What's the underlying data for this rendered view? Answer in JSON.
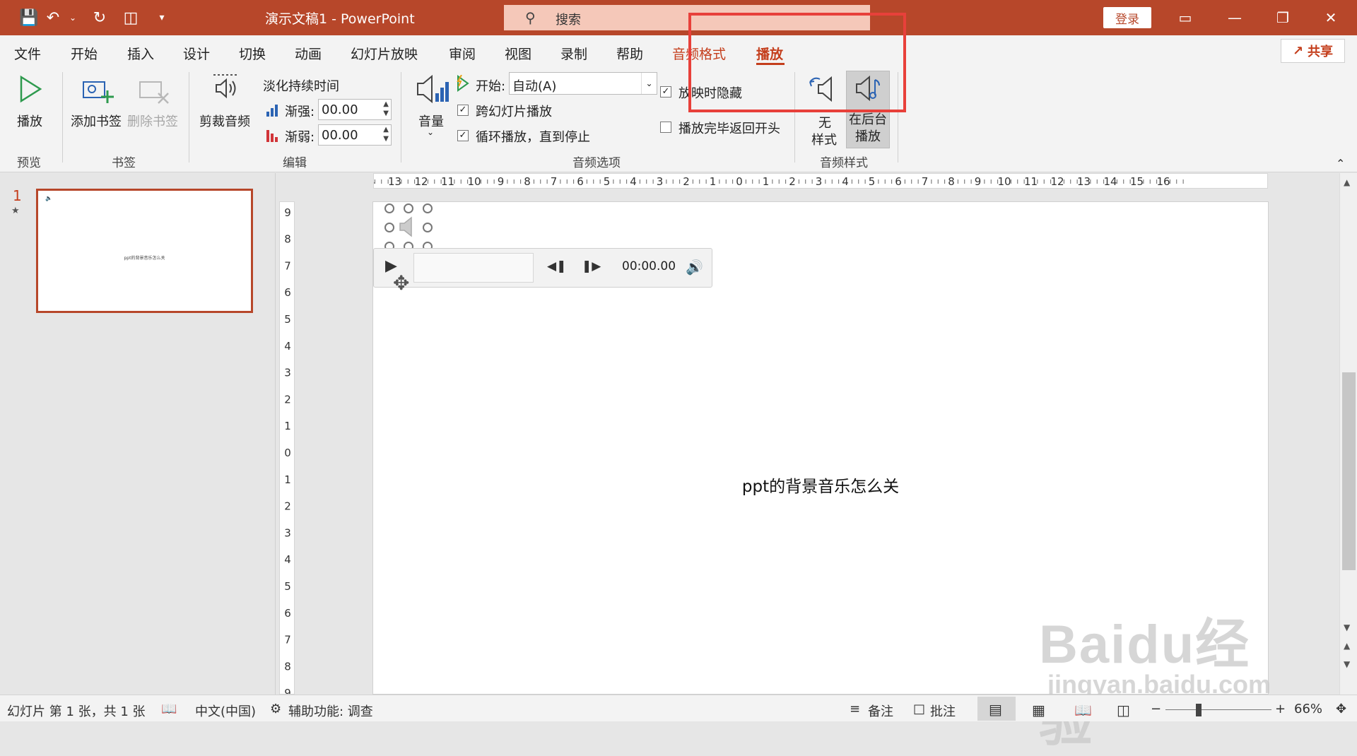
{
  "titlebar": {
    "doc_title": "演示文稿1  -  PowerPoint",
    "search_placeholder": "搜索",
    "login_label": "登录",
    "quick_access_icons": [
      "save-icon",
      "undo-icon",
      "redo-icon",
      "present-icon",
      "customize-icon"
    ]
  },
  "tabs": [
    "文件",
    "开始",
    "插入",
    "设计",
    "切换",
    "动画",
    "幻灯片放映",
    "审阅",
    "视图",
    "录制",
    "帮助",
    "音频格式",
    "播放"
  ],
  "active_tab": "播放",
  "share_label": "共享",
  "ribbon": {
    "play_label": "播放",
    "preview_group": "预览",
    "add_bookmark": "添加书签",
    "remove_bookmark": "删除书签",
    "bookmark_group": "书签",
    "trim_audio": "剪裁音频",
    "fade_duration": "淡化持续时间",
    "fade_in_label": "渐强:",
    "fade_in_value": "00.00",
    "fade_out_label": "渐弱:",
    "fade_out_value": "00.00",
    "edit_group": "编辑",
    "volume_label": "音量",
    "start_label": "开始:",
    "start_value": "自动(A)",
    "play_across_slides": "跨幻灯片播放",
    "play_across_slides_checked": true,
    "loop_until_stopped": "循环播放，直到停止",
    "loop_until_stopped_checked": true,
    "hide_during_show": "放映时隐藏",
    "hide_during_show_checked": true,
    "rewind_after_playing": "播放完毕返回开头",
    "rewind_after_playing_checked": false,
    "audio_options_group": "音频选项",
    "no_style_line1": "无",
    "no_style_line2": "样式",
    "bg_play_line1": "在后台",
    "bg_play_line2": "播放",
    "audio_styles_group": "音频样式"
  },
  "thumbnails": {
    "slide_number": "1",
    "thumb_text": "ppt的背景音乐怎么关"
  },
  "slide": {
    "text": "ppt的背景音乐怎么关",
    "player_time": "00:00.00"
  },
  "statusbar": {
    "slide_info": "幻灯片 第 1 张，共 1 张",
    "language": "中文(中国)",
    "accessibility": "辅助功能: 调查",
    "notes": "备注",
    "comments": "批注",
    "zoom": "66%"
  },
  "watermark": {
    "line1": "Baidu经验",
    "line2": "jingyan.baidu.com"
  },
  "colors": {
    "brand": "#b7472a",
    "highlight": "#e8403a"
  }
}
